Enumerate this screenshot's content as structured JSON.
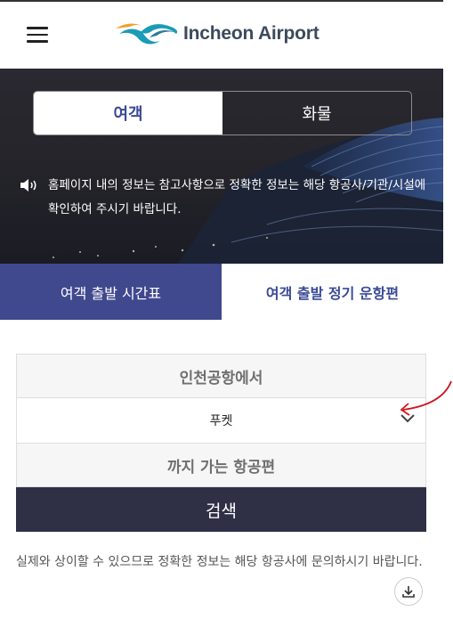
{
  "header": {
    "logo_text": "Incheon Airport",
    "menu_icon": "hamburger-menu-icon"
  },
  "banner": {
    "toggle": [
      "여객",
      "화물"
    ],
    "notice": "홈페이지 내의 정보는 참고사항으로 정확한 정보는 해당 항공사/기관/시설에 확인하여 주시기 바랍니다."
  },
  "tabs": [
    "여객 출발 시간표",
    "여객 출발 정기 운항편"
  ],
  "form": {
    "from_label": "인천공항에서",
    "destination": "푸켓",
    "to_label": "까지 가는 항공편",
    "search_label": "검색"
  },
  "disclaimer": "실제와 상이할 수 있으므로 정확한 정보는 해당 항공사에 문의하시기 바랍니다.",
  "colors": {
    "accent": "#40488e",
    "search_button": "#2f3046",
    "annotation_arrow": "#d0161f"
  }
}
